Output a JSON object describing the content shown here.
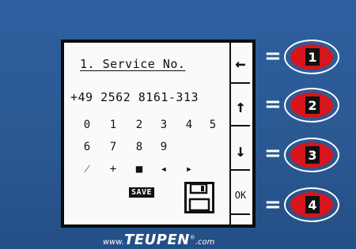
{
  "screen": {
    "title": "1. Service No.",
    "phone_number": "+49 2562 8161-313",
    "keypad": {
      "row1": [
        "0",
        "1",
        "2",
        "3",
        "4",
        "5"
      ],
      "row2": [
        "6",
        "7",
        "8",
        "9"
      ],
      "row3": [
        "⁄",
        "+",
        "■",
        "◂",
        "▸"
      ]
    },
    "save_label": "SAVE",
    "save_icon": "floppy-disk-icon"
  },
  "softkeys": [
    {
      "label": "←",
      "icon": "arrow-left-icon"
    },
    {
      "label": "↑",
      "icon": "arrow-up-icon"
    },
    {
      "label": "↓",
      "icon": "arrow-down-icon"
    },
    {
      "label": "OK",
      "icon": "ok-icon"
    }
  ],
  "legend": {
    "equals": "=",
    "keys": [
      "1",
      "2",
      "3",
      "4"
    ],
    "key_color": "#d8141c"
  },
  "brand": {
    "prefix": "www.",
    "name": "TEUPEN",
    "reg": "®",
    "suffix": ".com"
  }
}
